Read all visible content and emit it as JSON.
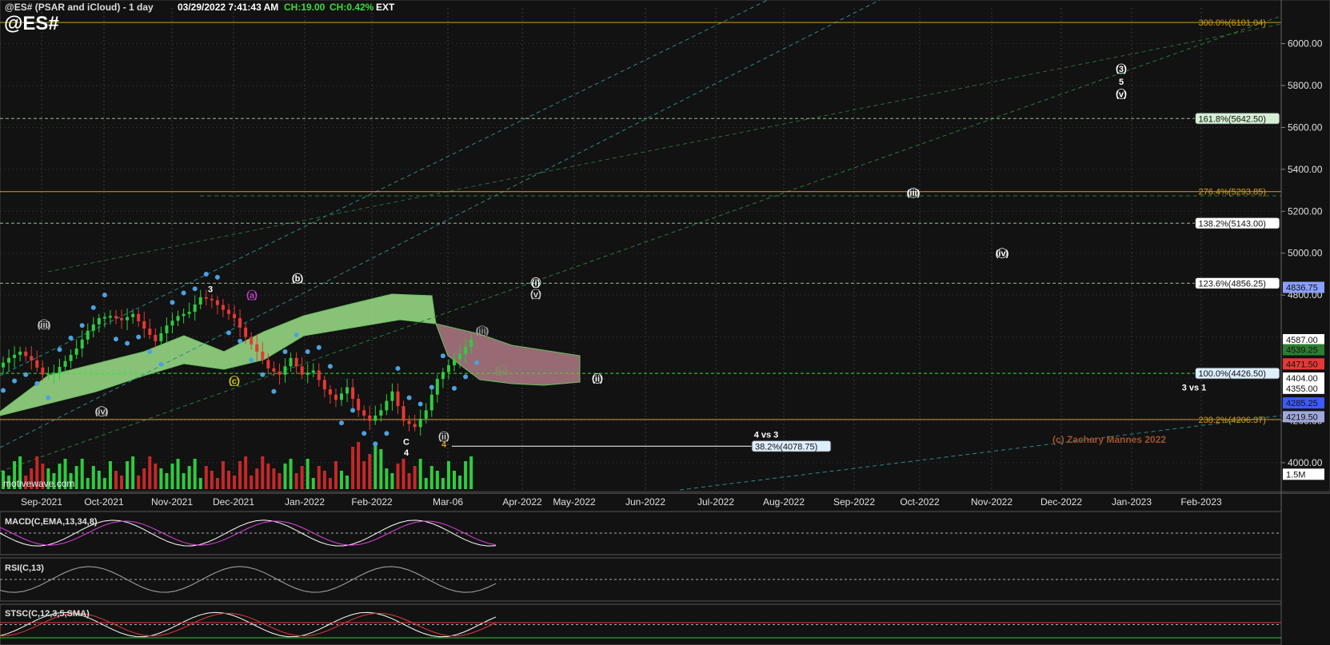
{
  "header": {
    "title": "@ES# (PSAR and iCloud) - 1 day",
    "timestamp": "03/29/2022 7:41:43 AM",
    "ch": "CH:19.00",
    "chpct": "CH:0.42%",
    "ext": "EXT",
    "symbol": "@ES#"
  },
  "watermark": "motivewave.com",
  "copyright": "(c) Zachary Mannes 2022",
  "panels": {
    "macd": "MACD(C,EMA,13,34,8)",
    "rsi": "RSI(C,13)",
    "stsc": "STSC(C,12,3,5,SMA)"
  },
  "chart_data": {
    "type": "candlestick",
    "instrument": "@ES#",
    "interval": "1 day",
    "ylim": [
      3870,
      6170
    ],
    "y_ticks": [
      4000,
      4200,
      4400,
      4600,
      4800,
      5000,
      5200,
      5400,
      5600,
      5800,
      6000
    ],
    "y_tick_labels": [
      "4000.00",
      "4200.00",
      "",
      "",
      "4800.00",
      "5000.00",
      "5200.00",
      "5400.00",
      "5600.00",
      "5800.00",
      "6000.00"
    ],
    "x_labels": [
      "Sep-2021",
      "Oct-2021",
      "Nov-2021",
      "Dec-2021",
      "Jan-2022",
      "Feb-2022",
      "Mar-06",
      "Apr-2022",
      "May-2022",
      "Jun-2022",
      "Jul-2022",
      "Aug-2022",
      "Sep-2022",
      "Oct-2022",
      "Nov-2022",
      "Dec-2022",
      "Jan-2023",
      "Feb-2023"
    ],
    "price_path": [
      [
        0,
        4455
      ],
      [
        2,
        4500
      ],
      [
        4,
        4530
      ],
      [
        6,
        4488
      ],
      [
        8,
        4420
      ],
      [
        10,
        4430
      ],
      [
        12,
        4485
      ],
      [
        14,
        4545
      ],
      [
        16,
        4630
      ],
      [
        18,
        4690
      ],
      [
        20,
        4700
      ],
      [
        22,
        4680
      ],
      [
        24,
        4710
      ],
      [
        26,
        4640
      ],
      [
        28,
        4580
      ],
      [
        30,
        4655
      ],
      [
        32,
        4700
      ],
      [
        34,
        4720
      ],
      [
        36,
        4790
      ],
      [
        38,
        4775
      ],
      [
        40,
        4730
      ],
      [
        42,
        4690
      ],
      [
        44,
        4600
      ],
      [
        46,
        4530
      ],
      [
        48,
        4450
      ],
      [
        50,
        4420
      ],
      [
        52,
        4500
      ],
      [
        54,
        4420
      ],
      [
        56,
        4440
      ],
      [
        58,
        4350
      ],
      [
        60,
        4300
      ],
      [
        62,
        4360
      ],
      [
        64,
        4250
      ],
      [
        66,
        4200
      ],
      [
        68,
        4250
      ],
      [
        70,
        4340
      ],
      [
        72,
        4200
      ],
      [
        74,
        4170
      ],
      [
        76,
        4250
      ],
      [
        78,
        4400
      ],
      [
        80,
        4465
      ],
      [
        82,
        4520
      ],
      [
        84,
        4587
      ]
    ],
    "fib_levels": [
      {
        "label": "300.0%(6101.04)",
        "value": 6101.04,
        "color": "#d4a017"
      },
      {
        "label": "161.8%(5642.50)",
        "value": 5642.5,
        "color": "#d4f0d4"
      },
      {
        "label": "276.4%(5293.85)",
        "value": 5293.85,
        "color": "#d4a017"
      },
      {
        "label": "138.2%(5143.00)",
        "value": 5143.0,
        "color": "#ffffff"
      },
      {
        "label": "123.6%(4856.25)",
        "value": 4856.25,
        "color": "#ffffff"
      },
      {
        "label": "100.0%(4426.50)",
        "value": 4426.5,
        "color": "#ddeeff"
      },
      {
        "label": "238.2%(4206.37)",
        "value": 4206.37,
        "color": "#d4a017"
      },
      {
        "label": "38.2%(4078.75)",
        "value": 4078.75,
        "color": "#ddeeff"
      }
    ],
    "price_badges": [
      {
        "label": "4836.75",
        "value": 4836.75,
        "color": "#8aa0ff"
      },
      {
        "label": "4587.00",
        "value": 4587.0,
        "color": "#ffffff"
      },
      {
        "label": "4539.25",
        "value": 4539.25,
        "color": "#2e7d32"
      },
      {
        "label": "4471.50",
        "value": 4471.5,
        "color": "#e53935"
      },
      {
        "label": "4404.00",
        "value": 4404.0,
        "color": "#ffffff"
      },
      {
        "label": "4355.00",
        "value": 4355.0,
        "color": "#ffffff"
      },
      {
        "label": "4285.25",
        "value": 4285.25,
        "color": "#3d5afe"
      },
      {
        "label": "4219.50",
        "value": 4219.5,
        "color": "#9fa8da"
      },
      {
        "label": "1.5M",
        "value": 3945,
        "color": "#ffffff"
      }
    ],
    "wave_labels": [
      {
        "text": "3",
        "x": 263,
        "value": 4830,
        "color": "#ffffff"
      },
      {
        "text": "(b)",
        "x": 372,
        "value": 4880,
        "color": "#ffffff"
      },
      {
        "text": "(a)",
        "x": 315,
        "value": 4800,
        "color": "#c040c0"
      },
      {
        "text": "(iii)",
        "x": 55,
        "value": 4660,
        "color": "#cccccc"
      },
      {
        "text": "(iv)",
        "x": 127,
        "value": 4245,
        "color": "#cccccc"
      },
      {
        "text": "(c)",
        "x": 293,
        "value": 4390,
        "color": "#d4d020"
      },
      {
        "text": "(i)",
        "x": 670,
        "value": 4860,
        "color": "#ffffff"
      },
      {
        "text": "(v)",
        "x": 670,
        "value": 4805,
        "color": "#cccccc"
      },
      {
        "text": "(iii)",
        "x": 603,
        "value": 4630,
        "color": "#999999"
      },
      {
        "text": "(iv)",
        "x": 627,
        "value": 4440,
        "color": "#888866"
      },
      {
        "text": "(ii)",
        "x": 747,
        "value": 4402,
        "color": "#ffffff"
      },
      {
        "text": "(iii)",
        "x": 1142,
        "value": 5288,
        "color": "#ffffff"
      },
      {
        "text": "(iv)",
        "x": 1253,
        "value": 5000,
        "color": "#ffffff"
      },
      {
        "text": "(3)",
        "x": 1402,
        "value": 5880,
        "color": "#ffffff"
      },
      {
        "text": "5",
        "x": 1402,
        "value": 5820,
        "color": "#ffffff"
      },
      {
        "text": "(v)",
        "x": 1402,
        "value": 5760,
        "color": "#ffffff"
      },
      {
        "text": "C",
        "x": 508,
        "value": 4100,
        "color": "#ffffff"
      },
      {
        "text": "4",
        "x": 508,
        "value": 4050,
        "color": "#ffffff"
      },
      {
        "text": "(ii)",
        "x": 555,
        "value": 4125,
        "color": "#cccccc"
      },
      {
        "text": "4",
        "x": 555,
        "value": 4090,
        "color": "#d4a017"
      }
    ],
    "annotations": [
      {
        "text": "4 vs 3",
        "x": 958,
        "value": 4135
      },
      {
        "text": "3 vs 1",
        "x": 1493,
        "value": 4360
      }
    ]
  }
}
